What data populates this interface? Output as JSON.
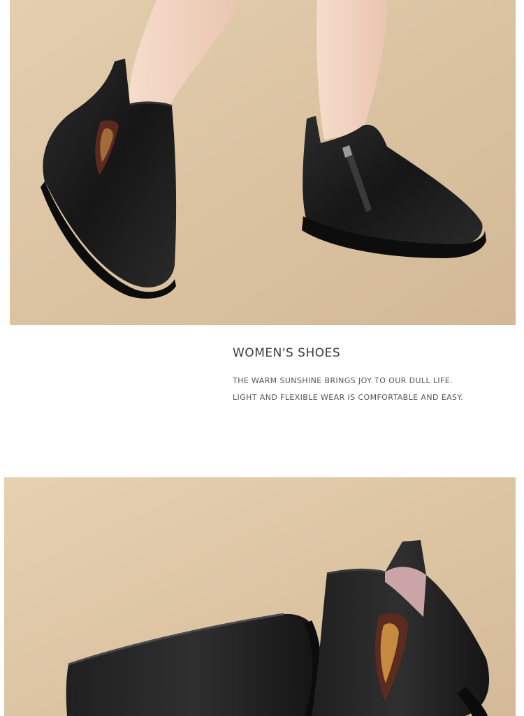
{
  "caption": {
    "title": "WOMEN'S SHOES",
    "lines": [
      "THE WARM SUNSHINE BRINGS JOY TO OUR DULL LIFE.",
      "LIGHT AND FLEXIBLE WEAR IS COMFORTABLE AND EASY."
    ]
  },
  "colors": {
    "backdrop": "#dcc4a2",
    "leather": "#1b1b1b",
    "skin": "#f2d6c3",
    "text": "#3b3b3b"
  }
}
